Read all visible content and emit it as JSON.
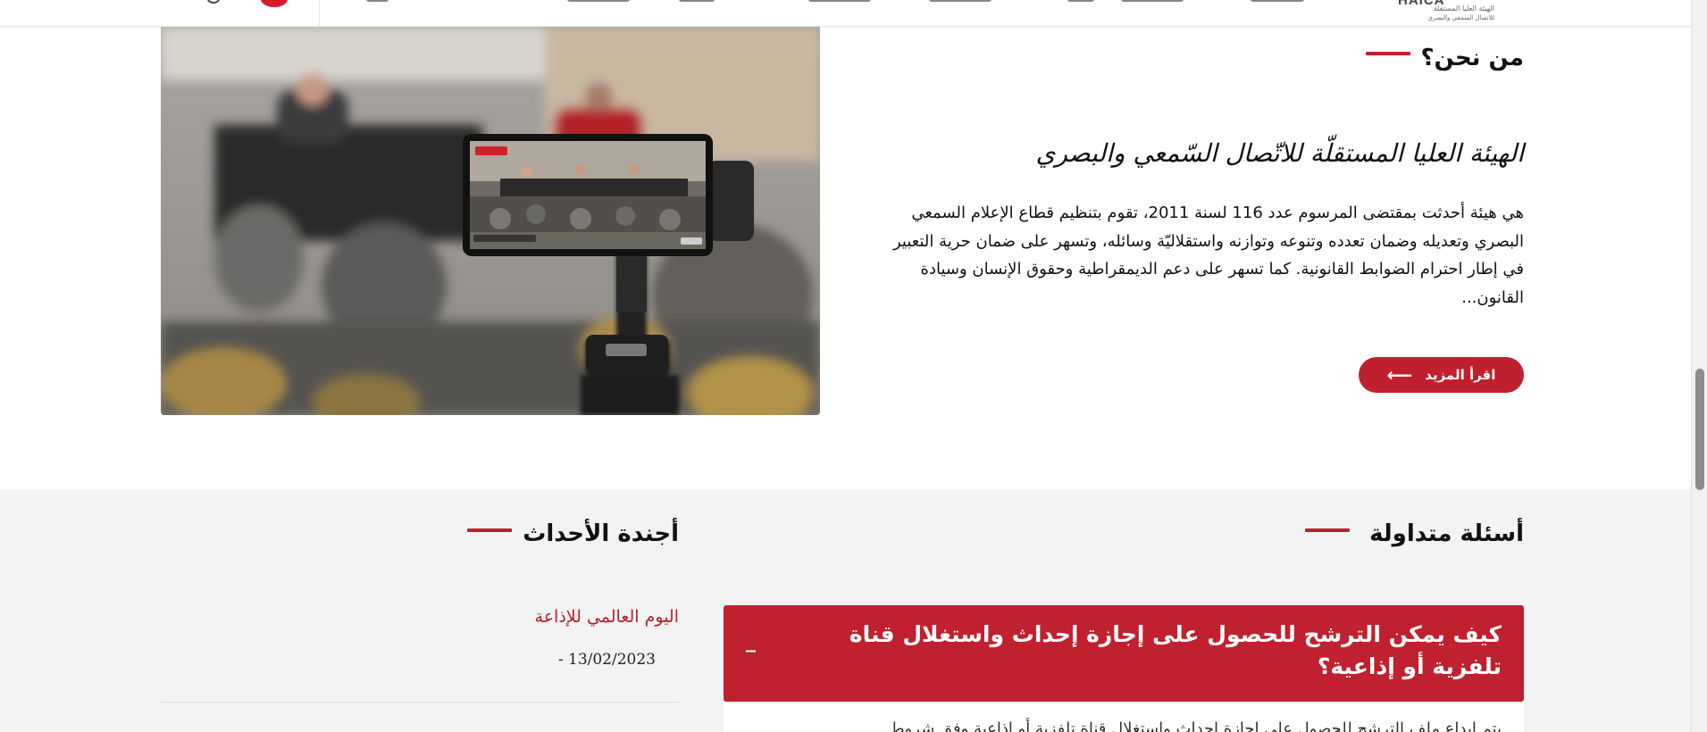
{
  "header": {
    "logo": {
      "mark": "HAICA",
      "line1": "الهيئة العليا المستقلة",
      "line2": "للاتصال السمعي والبصري"
    }
  },
  "about": {
    "heading": "من نحن؟",
    "subtitle": "الهيئة العليا المستقلّة للاتّصال السّمعي والبصري",
    "body": "هي هيئة أحدثت بمقتضى المرسوم عدد 116 لسنة 2011، تقوم بتنظيم قطاع الإعلام السمعي البصري وتعديله وضمان تعدده وتنوعه وتوازنه واستقلاليّة وسائله، وتسهر على ضمان حرية التعبير في إطار احترام الضوابط القانونية. كما تسهر على دعم الديمقراطية وحقوق الإنسان وسيادة القانون...",
    "read_more": "اقرأ المزيد",
    "read_more_arrow": "⟵"
  },
  "faq": {
    "heading": "أسئلة متداولة",
    "items": [
      {
        "question": "كيف يمكن الترشح للحصول على إجازة إحداث واستغلال قناة تلفزية أو إذاعية؟",
        "toggle": "_",
        "answer": "يتم إيداع ملف الترشح للحصول على إجازة إحداث واستغلال قناة تلفزية أو إذاعية وفق شروط"
      }
    ]
  },
  "events": {
    "heading": "أجندة الأحداث",
    "items": [
      {
        "title": "اليوم العالمي للإذاعة",
        "date": "- 13/02/2023"
      }
    ]
  },
  "colors": {
    "accent": "#c1202e",
    "gray_bg": "#f3f3f3"
  }
}
